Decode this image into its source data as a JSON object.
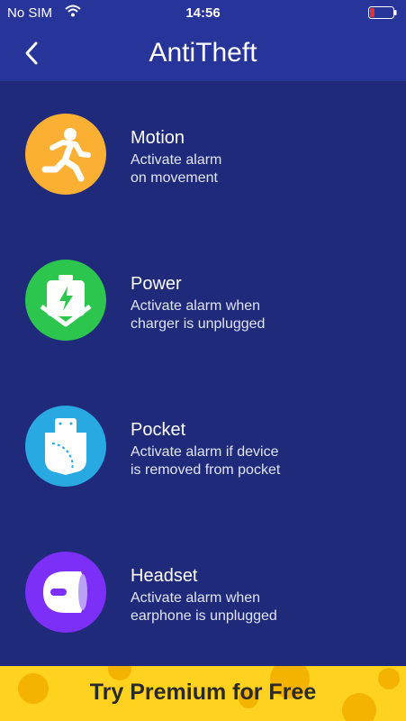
{
  "status": {
    "carrier": "No SIM",
    "time": "14:56",
    "wifi_icon": "wifi-icon",
    "battery_icon": "battery-low-icon",
    "battery_color": "#e8312f"
  },
  "header": {
    "title": "AntiTheft",
    "back_icon": "chevron-left-icon"
  },
  "features": [
    {
      "title": "Motion",
      "desc_line1": "Activate alarm",
      "desc_line2": "on movement",
      "icon": "running-person-icon",
      "color": "#fbb034"
    },
    {
      "title": "Power",
      "desc_line1": "Activate alarm when",
      "desc_line2": "charger is unplugged",
      "icon": "battery-charging-icon",
      "color": "#2cc64f"
    },
    {
      "title": "Pocket",
      "desc_line1": "Activate alarm if device",
      "desc_line2": "is removed from pocket",
      "icon": "pocket-phone-icon",
      "color": "#29a9e1"
    },
    {
      "title": "Headset",
      "desc_line1": "Activate alarm when",
      "desc_line2": "earphone is unplugged",
      "icon": "earphone-icon",
      "color": "#7b2ff7"
    }
  ],
  "banner": {
    "label": "Try Premium for Free",
    "color": "#ffd21f"
  }
}
